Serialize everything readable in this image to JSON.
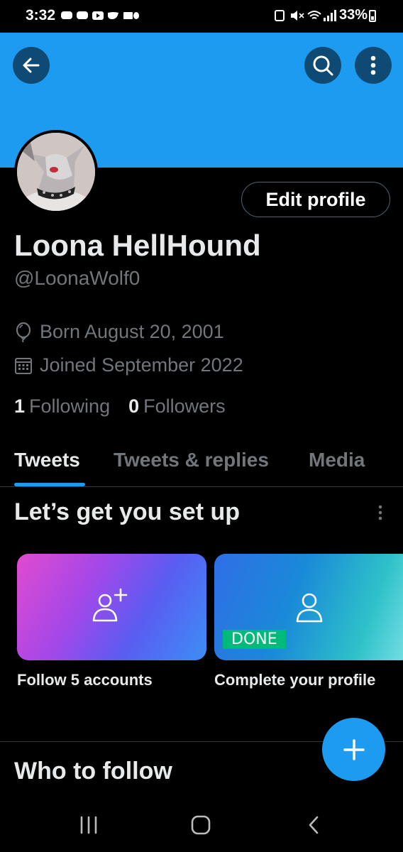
{
  "status_bar": {
    "time": "3:32",
    "battery": "33%",
    "left_icons": [
      "discord-icon",
      "discord-icon",
      "youtube-icon",
      "twitter-icon",
      "folder-icon",
      "layers-icon"
    ],
    "right_icons": [
      "lock-icon",
      "mute-icon",
      "wifi-icon",
      "signal-icon",
      "battery-icon"
    ]
  },
  "header": {
    "banner_color": "#1d9bf0",
    "back_icon": "arrow-left-icon",
    "search_icon": "search-icon",
    "more_icon": "more-vertical-icon"
  },
  "profile": {
    "edit_label": "Edit profile",
    "name": "Loona HellHound",
    "handle": "@LoonaWolf0",
    "born": "Born August 20, 2001",
    "joined": "Joined September 2022",
    "following_count": "1",
    "following_label": "Following",
    "followers_count": "0",
    "followers_label": "Followers"
  },
  "tabs": [
    {
      "label": "Tweets",
      "active": true
    },
    {
      "label": "Tweets & replies",
      "active": false
    },
    {
      "label": "Media",
      "active": false
    }
  ],
  "setup": {
    "title": "Let’s get you set up",
    "cards": [
      {
        "label": "Follow 5 accounts",
        "icon": "add-user-icon"
      },
      {
        "label": "Complete your profile",
        "icon": "user-icon",
        "badge": "DONE"
      }
    ]
  },
  "who_to_follow": {
    "title": "Who to follow"
  },
  "fab": {
    "icon": "plus-icon"
  },
  "nav": [
    "recent-apps-icon",
    "home-icon",
    "back-icon"
  ],
  "colors": {
    "accent": "#1d9bf0",
    "done": "#00ba7c",
    "muted": "#71767b"
  }
}
